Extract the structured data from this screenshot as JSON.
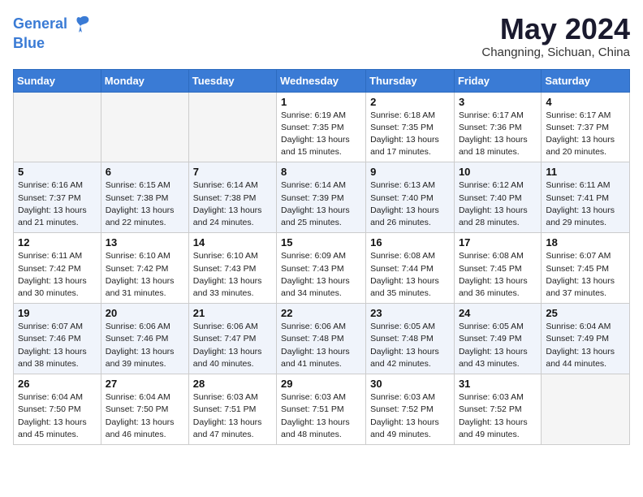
{
  "logo": {
    "line1": "General",
    "line2": "Blue"
  },
  "title": "May 2024",
  "location": "Changning, Sichuan, China",
  "weekdays": [
    "Sunday",
    "Monday",
    "Tuesday",
    "Wednesday",
    "Thursday",
    "Friday",
    "Saturday"
  ],
  "weeks": [
    [
      {
        "num": "",
        "info": ""
      },
      {
        "num": "",
        "info": ""
      },
      {
        "num": "",
        "info": ""
      },
      {
        "num": "1",
        "info": "Sunrise: 6:19 AM\nSunset: 7:35 PM\nDaylight: 13 hours\nand 15 minutes."
      },
      {
        "num": "2",
        "info": "Sunrise: 6:18 AM\nSunset: 7:35 PM\nDaylight: 13 hours\nand 17 minutes."
      },
      {
        "num": "3",
        "info": "Sunrise: 6:17 AM\nSunset: 7:36 PM\nDaylight: 13 hours\nand 18 minutes."
      },
      {
        "num": "4",
        "info": "Sunrise: 6:17 AM\nSunset: 7:37 PM\nDaylight: 13 hours\nand 20 minutes."
      }
    ],
    [
      {
        "num": "5",
        "info": "Sunrise: 6:16 AM\nSunset: 7:37 PM\nDaylight: 13 hours\nand 21 minutes."
      },
      {
        "num": "6",
        "info": "Sunrise: 6:15 AM\nSunset: 7:38 PM\nDaylight: 13 hours\nand 22 minutes."
      },
      {
        "num": "7",
        "info": "Sunrise: 6:14 AM\nSunset: 7:38 PM\nDaylight: 13 hours\nand 24 minutes."
      },
      {
        "num": "8",
        "info": "Sunrise: 6:14 AM\nSunset: 7:39 PM\nDaylight: 13 hours\nand 25 minutes."
      },
      {
        "num": "9",
        "info": "Sunrise: 6:13 AM\nSunset: 7:40 PM\nDaylight: 13 hours\nand 26 minutes."
      },
      {
        "num": "10",
        "info": "Sunrise: 6:12 AM\nSunset: 7:40 PM\nDaylight: 13 hours\nand 28 minutes."
      },
      {
        "num": "11",
        "info": "Sunrise: 6:11 AM\nSunset: 7:41 PM\nDaylight: 13 hours\nand 29 minutes."
      }
    ],
    [
      {
        "num": "12",
        "info": "Sunrise: 6:11 AM\nSunset: 7:42 PM\nDaylight: 13 hours\nand 30 minutes."
      },
      {
        "num": "13",
        "info": "Sunrise: 6:10 AM\nSunset: 7:42 PM\nDaylight: 13 hours\nand 31 minutes."
      },
      {
        "num": "14",
        "info": "Sunrise: 6:10 AM\nSunset: 7:43 PM\nDaylight: 13 hours\nand 33 minutes."
      },
      {
        "num": "15",
        "info": "Sunrise: 6:09 AM\nSunset: 7:43 PM\nDaylight: 13 hours\nand 34 minutes."
      },
      {
        "num": "16",
        "info": "Sunrise: 6:08 AM\nSunset: 7:44 PM\nDaylight: 13 hours\nand 35 minutes."
      },
      {
        "num": "17",
        "info": "Sunrise: 6:08 AM\nSunset: 7:45 PM\nDaylight: 13 hours\nand 36 minutes."
      },
      {
        "num": "18",
        "info": "Sunrise: 6:07 AM\nSunset: 7:45 PM\nDaylight: 13 hours\nand 37 minutes."
      }
    ],
    [
      {
        "num": "19",
        "info": "Sunrise: 6:07 AM\nSunset: 7:46 PM\nDaylight: 13 hours\nand 38 minutes."
      },
      {
        "num": "20",
        "info": "Sunrise: 6:06 AM\nSunset: 7:46 PM\nDaylight: 13 hours\nand 39 minutes."
      },
      {
        "num": "21",
        "info": "Sunrise: 6:06 AM\nSunset: 7:47 PM\nDaylight: 13 hours\nand 40 minutes."
      },
      {
        "num": "22",
        "info": "Sunrise: 6:06 AM\nSunset: 7:48 PM\nDaylight: 13 hours\nand 41 minutes."
      },
      {
        "num": "23",
        "info": "Sunrise: 6:05 AM\nSunset: 7:48 PM\nDaylight: 13 hours\nand 42 minutes."
      },
      {
        "num": "24",
        "info": "Sunrise: 6:05 AM\nSunset: 7:49 PM\nDaylight: 13 hours\nand 43 minutes."
      },
      {
        "num": "25",
        "info": "Sunrise: 6:04 AM\nSunset: 7:49 PM\nDaylight: 13 hours\nand 44 minutes."
      }
    ],
    [
      {
        "num": "26",
        "info": "Sunrise: 6:04 AM\nSunset: 7:50 PM\nDaylight: 13 hours\nand 45 minutes."
      },
      {
        "num": "27",
        "info": "Sunrise: 6:04 AM\nSunset: 7:50 PM\nDaylight: 13 hours\nand 46 minutes."
      },
      {
        "num": "28",
        "info": "Sunrise: 6:03 AM\nSunset: 7:51 PM\nDaylight: 13 hours\nand 47 minutes."
      },
      {
        "num": "29",
        "info": "Sunrise: 6:03 AM\nSunset: 7:51 PM\nDaylight: 13 hours\nand 48 minutes."
      },
      {
        "num": "30",
        "info": "Sunrise: 6:03 AM\nSunset: 7:52 PM\nDaylight: 13 hours\nand 49 minutes."
      },
      {
        "num": "31",
        "info": "Sunrise: 6:03 AM\nSunset: 7:52 PM\nDaylight: 13 hours\nand 49 minutes."
      },
      {
        "num": "",
        "info": ""
      }
    ]
  ]
}
